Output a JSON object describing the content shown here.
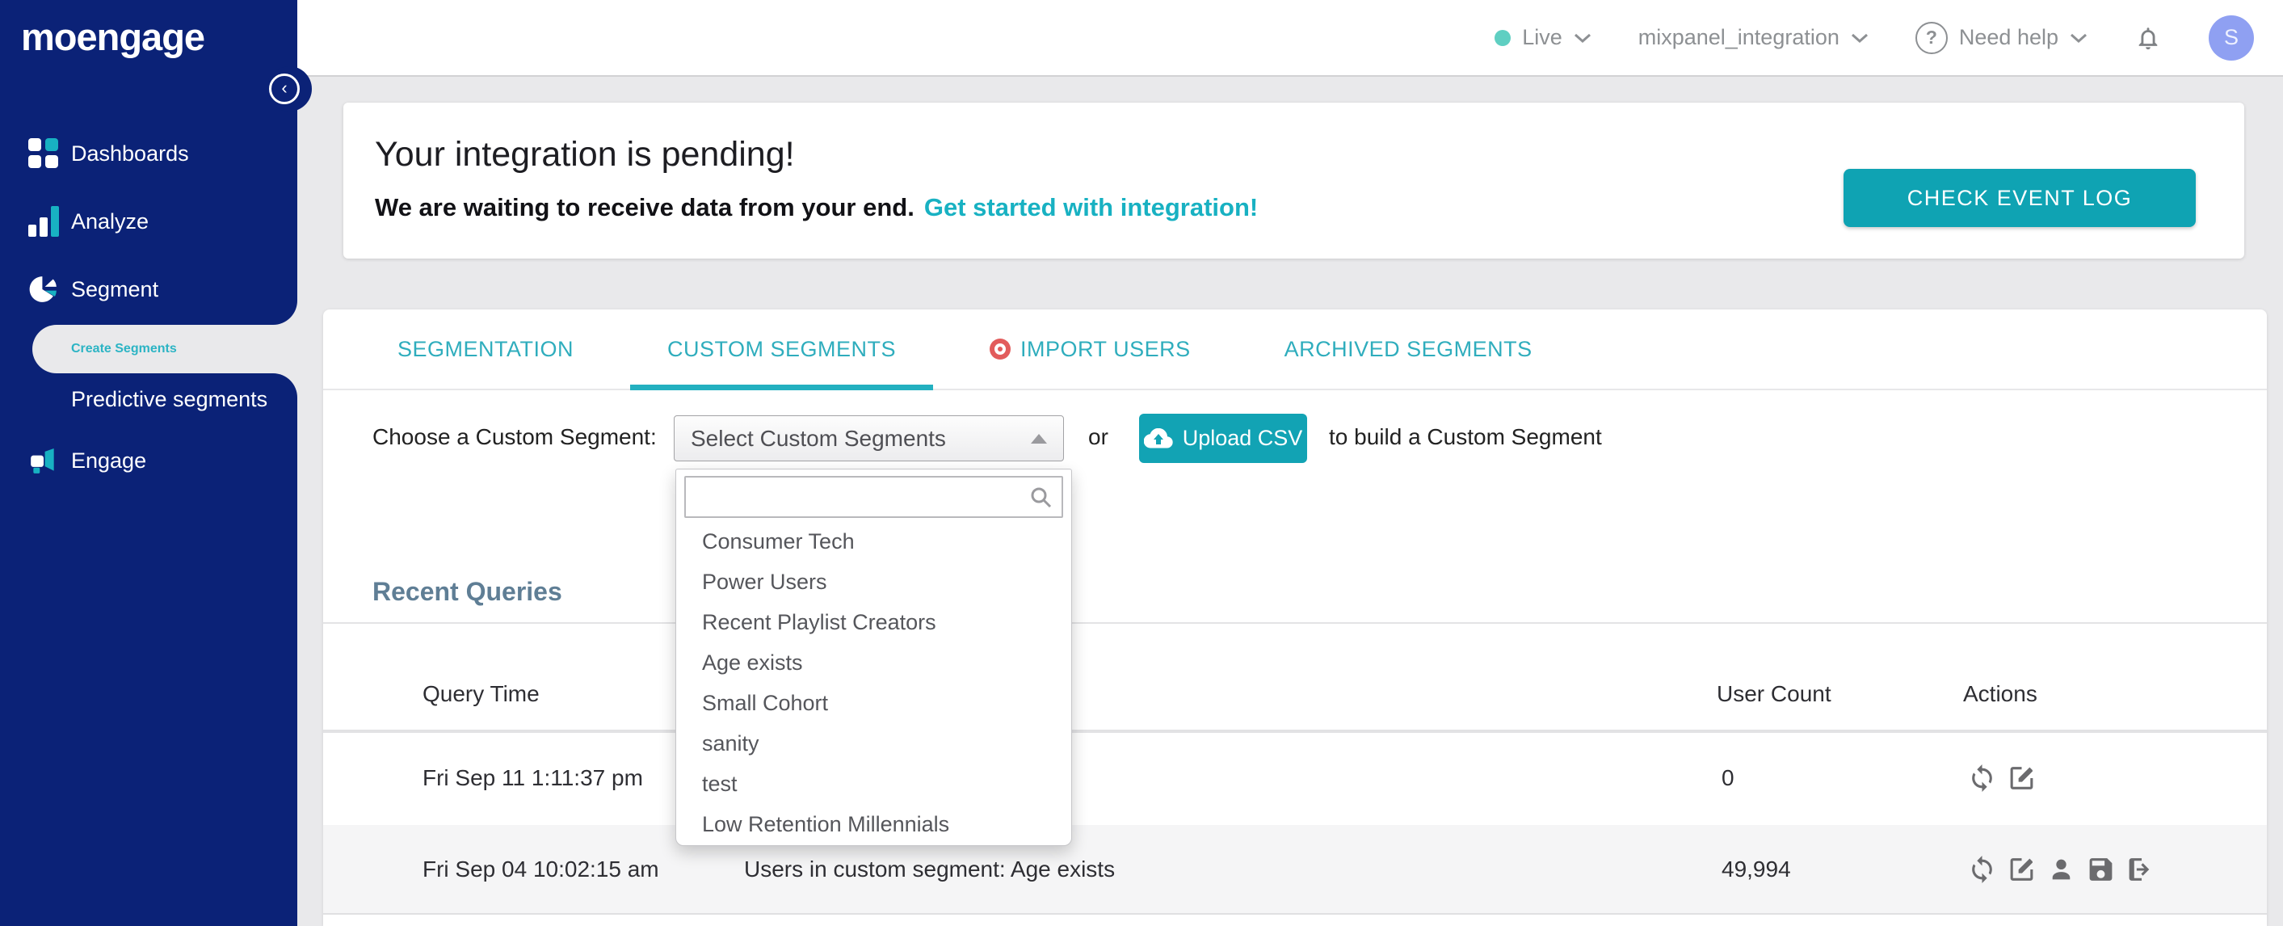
{
  "sidebar": {
    "logo": "moengage",
    "items": [
      {
        "label": "Dashboards"
      },
      {
        "label": "Analyze"
      },
      {
        "label": "Segment"
      },
      {
        "label": "Engage"
      }
    ],
    "sub_items": [
      {
        "label": "Create Segments"
      },
      {
        "label": "Predictive segments"
      }
    ]
  },
  "header": {
    "env_label": "Live",
    "app_name": "mixpanel_integration",
    "help_label": "Need help",
    "avatar_initial": "S"
  },
  "banner": {
    "title": "Your integration is pending!",
    "subtitle": "We are waiting to receive data from your end.",
    "link_label": "Get started with integration!",
    "button_label": "CHECK EVENT LOG"
  },
  "tabs": [
    {
      "label": "SEGMENTATION",
      "active": false
    },
    {
      "label": "CUSTOM SEGMENTS",
      "active": true
    },
    {
      "label": "IMPORT USERS",
      "active": false
    },
    {
      "label": "ARCHIVED SEGMENTS",
      "active": false
    }
  ],
  "segment_chooser": {
    "label": "Choose a Custom Segment:",
    "select_value": "Select Custom Segments",
    "or_text": "or",
    "upload_button_label": "Upload CSV",
    "suffix_text": "to build a Custom Segment",
    "search_placeholder": "",
    "dropdown_options": [
      "Consumer Tech",
      "Power Users",
      "Recent Playlist Creators",
      "Age exists",
      "Small Cohort",
      "sanity",
      "test",
      "Low Retention Millennials"
    ]
  },
  "recent_queries": {
    "title": "Recent Queries",
    "columns": [
      "Query Time",
      "User Count",
      "Actions"
    ],
    "rows": [
      {
        "time": "Fri Sep 11 1:11:37 pm",
        "user_count": "0"
      },
      {
        "time": "Fri Sep 04 10:02:15 am",
        "description": "Users in custom segment: Age exists",
        "user_count": "49,994"
      }
    ]
  },
  "colors": {
    "sidebar_navy": "#0b2277",
    "accent_teal": "#12a3b4",
    "tab_teal": "#2fadbd",
    "link_teal": "#18b1c2",
    "heading_slate": "#5f7e95",
    "import_red": "#e25c5c",
    "avatar_purple": "#8fa0f2",
    "live_dot_teal": "#5fcfc2",
    "page_bg": "#e9e9eb"
  }
}
